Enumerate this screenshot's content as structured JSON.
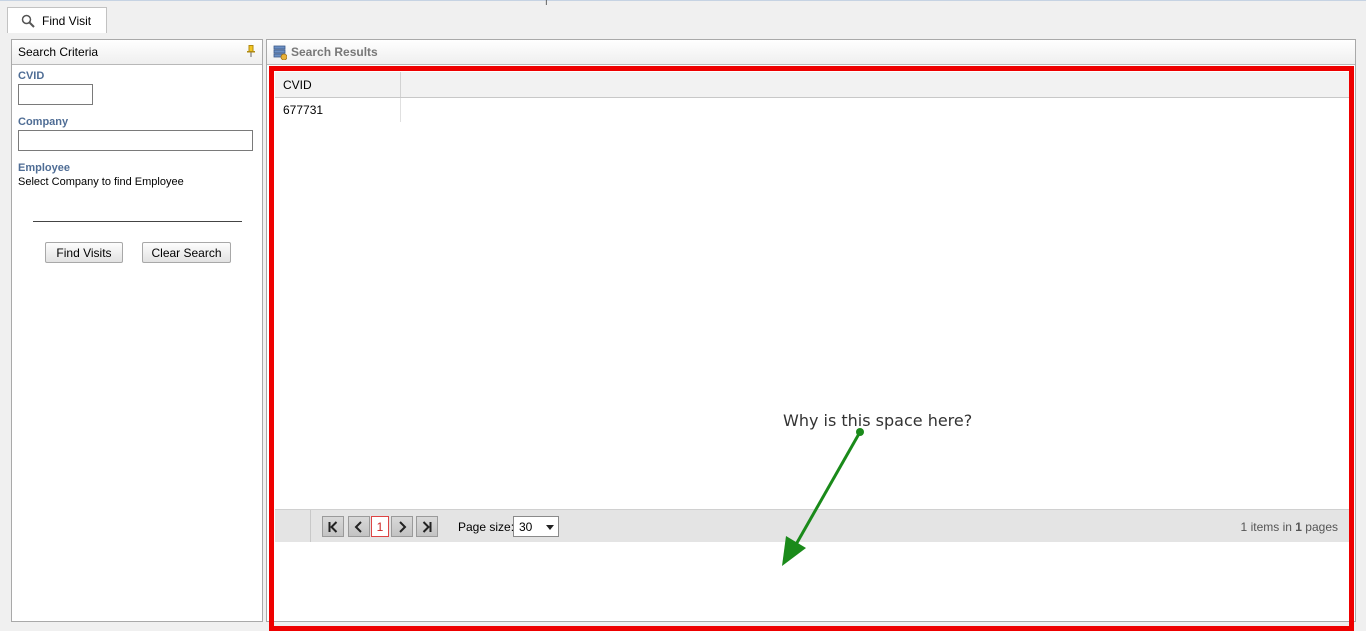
{
  "tab": {
    "label": "Find Visit",
    "icon": "search-icon"
  },
  "search_panel": {
    "title": "Search Criteria",
    "pin_icon": "pin-icon",
    "cvid_label": "CVID",
    "cvid_value": "",
    "company_label": "Company",
    "company_value": "",
    "employee_label": "Employee",
    "employee_hint": "Select Company to find Employee",
    "find_button": "Find Visits",
    "clear_button": "Clear Search"
  },
  "results_panel": {
    "title": "Search Results",
    "icon": "database-icon",
    "columns": [
      "CVID"
    ],
    "rows": [
      [
        "677731"
      ]
    ],
    "pager": {
      "current_page": "1",
      "page_size_label": "Page size:",
      "page_size": "30",
      "items_count": "1",
      "pages_count": "1",
      "info_mid": "items in",
      "info_tail": "pages"
    }
  },
  "annotation": {
    "text": "Why is this space here?",
    "frame_color": "#ee0000",
    "arrow_color": "#1a8a1a"
  }
}
